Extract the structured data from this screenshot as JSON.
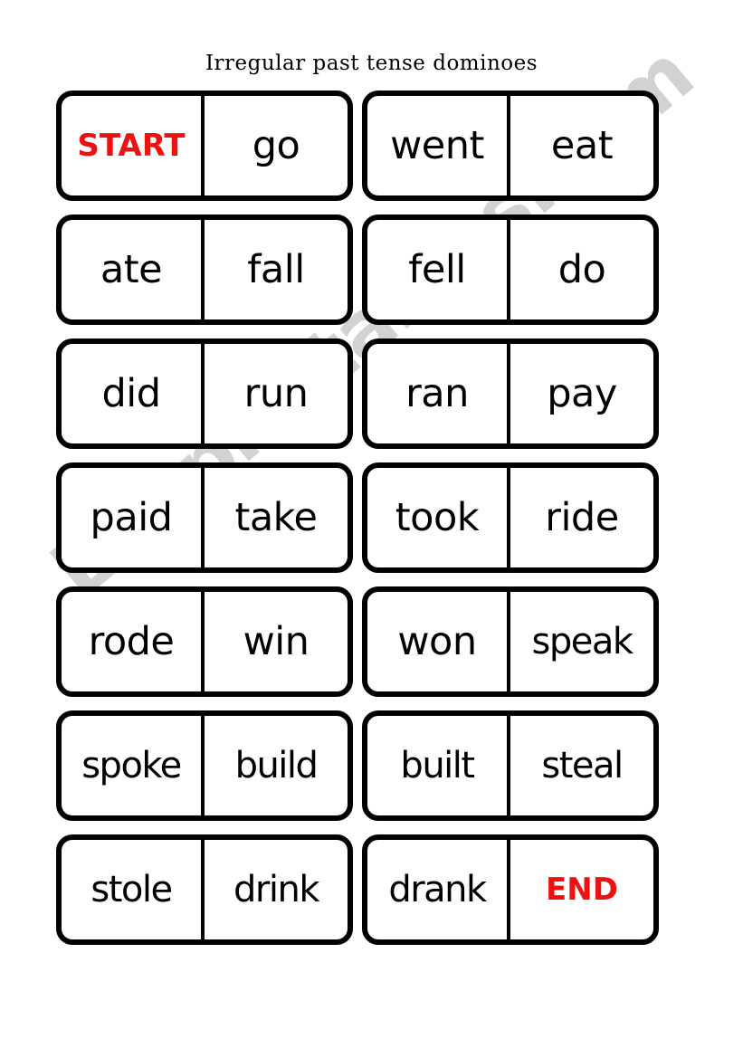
{
  "title": "Irregular past tense dominoes",
  "watermark": {
    "text": "ESLprintables.com",
    "color": "#d2d2d2"
  },
  "colors": {
    "ink": "#000000",
    "marker_red": "#ee1111",
    "paper": "#ffffff"
  },
  "grid": {
    "columns": 2,
    "rows": 7,
    "rows_data": [
      {
        "left_domino": {
          "left": "START",
          "right": "go",
          "left_kind": "marker",
          "right_kind": "word"
        },
        "right_domino": {
          "left": "went",
          "right": "eat",
          "left_kind": "word",
          "right_kind": "word"
        }
      },
      {
        "left_domino": {
          "left": "ate",
          "right": "fall",
          "left_kind": "word",
          "right_kind": "word"
        },
        "right_domino": {
          "left": "fell",
          "right": "do",
          "left_kind": "word",
          "right_kind": "word"
        }
      },
      {
        "left_domino": {
          "left": "did",
          "right": "run",
          "left_kind": "word",
          "right_kind": "word"
        },
        "right_domino": {
          "left": "ran",
          "right": "pay",
          "left_kind": "word",
          "right_kind": "word"
        }
      },
      {
        "left_domino": {
          "left": "paid",
          "right": "take",
          "left_kind": "word",
          "right_kind": "word"
        },
        "right_domino": {
          "left": "took",
          "right": "ride",
          "left_kind": "word",
          "right_kind": "word"
        }
      },
      {
        "left_domino": {
          "left": "rode",
          "right": "win",
          "left_kind": "word",
          "right_kind": "word"
        },
        "right_domino": {
          "left": "won",
          "right": "speak",
          "left_kind": "word",
          "right_kind": "tight"
        }
      },
      {
        "left_domino": {
          "left": "spoke",
          "right": "build",
          "left_kind": "tight",
          "right_kind": "tight"
        },
        "right_domino": {
          "left": "built",
          "right": "steal",
          "left_kind": "tight",
          "right_kind": "tight"
        }
      },
      {
        "left_domino": {
          "left": "stole",
          "right": "drink",
          "left_kind": "tight",
          "right_kind": "tight"
        },
        "right_domino": {
          "left": "drank",
          "right": "END",
          "left_kind": "tight",
          "right_kind": "marker"
        }
      }
    ]
  }
}
